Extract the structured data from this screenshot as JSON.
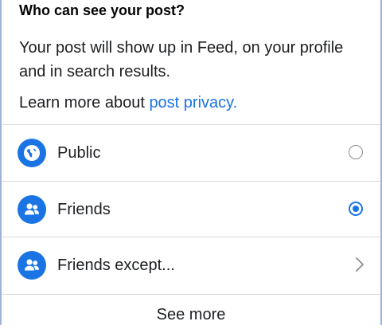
{
  "dialog": {
    "title": "Who can see your post?",
    "description": "Your post will show up in Feed, on your profile and in search results.",
    "learn_more_prefix": "Learn more about ",
    "learn_more_link": "post privacy."
  },
  "options": [
    {
      "label": "Public",
      "icon": "globe-icon",
      "control": "radio",
      "selected": false
    },
    {
      "label": "Friends",
      "icon": "friends-icon",
      "control": "radio",
      "selected": true
    },
    {
      "label": "Friends except...",
      "icon": "friends-icon",
      "control": "chevron",
      "selected": false
    }
  ],
  "footer": {
    "see_more_label": "See more"
  },
  "colors": {
    "accent": "#1b74e4",
    "text": "#1c1e21",
    "divider": "#d9d9d9",
    "panel_border": "#9fb3d6"
  }
}
